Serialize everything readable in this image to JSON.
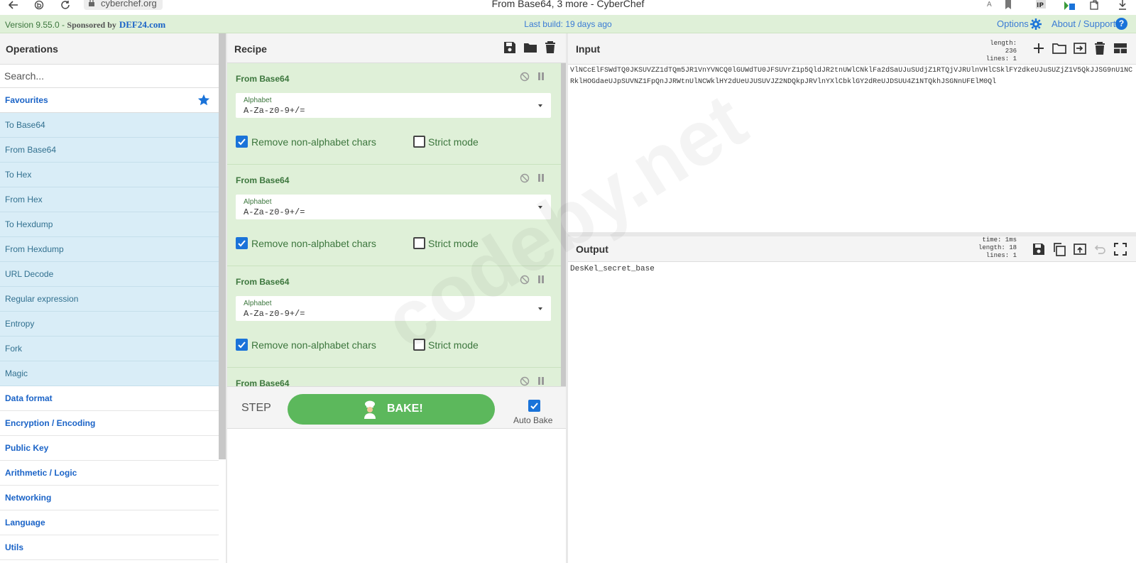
{
  "browser": {
    "url": "cyberchef.org",
    "title": "From Base64, 3 more - CyberChef"
  },
  "banner": {
    "version": "Version 9.55.0 - ",
    "sponsor": "Sponsored by",
    "sponsor_site": "DEF24.com",
    "last_build": "Last build: 19 days ago",
    "options": "Options",
    "about": "About / Support",
    "help": "?"
  },
  "operations": {
    "title": "Operations",
    "search_placeholder": "Search...",
    "favourites": "Favourites",
    "favourite_items": [
      "To Base64",
      "From Base64",
      "To Hex",
      "From Hex",
      "To Hexdump",
      "From Hexdump",
      "URL Decode",
      "Regular expression",
      "Entropy",
      "Fork",
      "Magic"
    ],
    "categories": [
      "Data format",
      "Encryption / Encoding",
      "Public Key",
      "Arithmetic / Logic",
      "Networking",
      "Language",
      "Utils"
    ]
  },
  "recipe": {
    "title": "Recipe",
    "ops": [
      {
        "name": "From Base64",
        "alphabet_label": "Alphabet",
        "alphabet": "A-Za-z0-9+/=",
        "remove_label": "Remove non-alphabet chars",
        "strict_label": "Strict mode"
      },
      {
        "name": "From Base64",
        "alphabet_label": "Alphabet",
        "alphabet": "A-Za-z0-9+/=",
        "remove_label": "Remove non-alphabet chars",
        "strict_label": "Strict mode"
      },
      {
        "name": "From Base64",
        "alphabet_label": "Alphabet",
        "alphabet": "A-Za-z0-9+/=",
        "remove_label": "Remove non-alphabet chars",
        "strict_label": "Strict mode"
      },
      {
        "name": "From Base64"
      }
    ],
    "step": "STEP",
    "bake": "BAKE!",
    "auto_bake": "Auto Bake"
  },
  "input": {
    "title": "Input",
    "length_label": "length:",
    "length": "236",
    "lines_label": "lines:",
    "lines": "1",
    "text": "VlNCcElFSWdTQ0JKSUVZZ1dTQm5JR1VnYVNCQ0lGUWdTU0JFSUVrZ1p5QldJR2tnUWlCNklFa2dSaUJuSUdjZ1RTQjVJRUlnVHlCSklFY2dkeUJuSUZjZ1V5QkJJSG9nU1NCRklHOGdaeUJpSUVNZ1FpQnJJRWtnUlNCWklHY2dUeUJUSUVJZ2NDQkpJRVlnYXlCbklGY2dReUJDSUU4Z1NTQkhJSGNnUFElM0Ql"
  },
  "output": {
    "title": "Output",
    "time_label": "time:",
    "time": "1ms",
    "length_label": "length:",
    "length": "18",
    "lines_label": "lines:",
    "lines": "1",
    "text": "DesKel_secret_base"
  },
  "watermark": "codeby.net"
}
